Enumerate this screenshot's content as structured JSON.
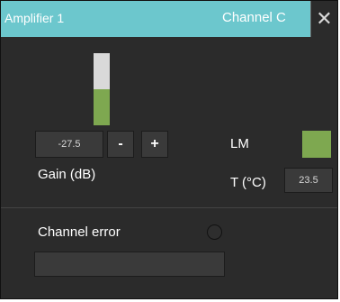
{
  "window": {
    "title": "Amplifier 1",
    "channel": "Channel C",
    "close_symbol": "✕"
  },
  "gain": {
    "level_fraction": 0.5,
    "value": "-27.5",
    "minus_label": "-",
    "plus_label": "+",
    "label": "Gain (dB)"
  },
  "status": {
    "lm_label": "LM",
    "lm_color": "#7ea850",
    "temp_label": "T (°C)",
    "temp_value": "23.5"
  },
  "error": {
    "label": "Channel error",
    "message": ""
  },
  "colors": {
    "titlebar": "#6cc7cd",
    "panel": "#2b2b2b",
    "meter_fill": "#7ea850",
    "meter_bg": "#d9d9d9"
  }
}
